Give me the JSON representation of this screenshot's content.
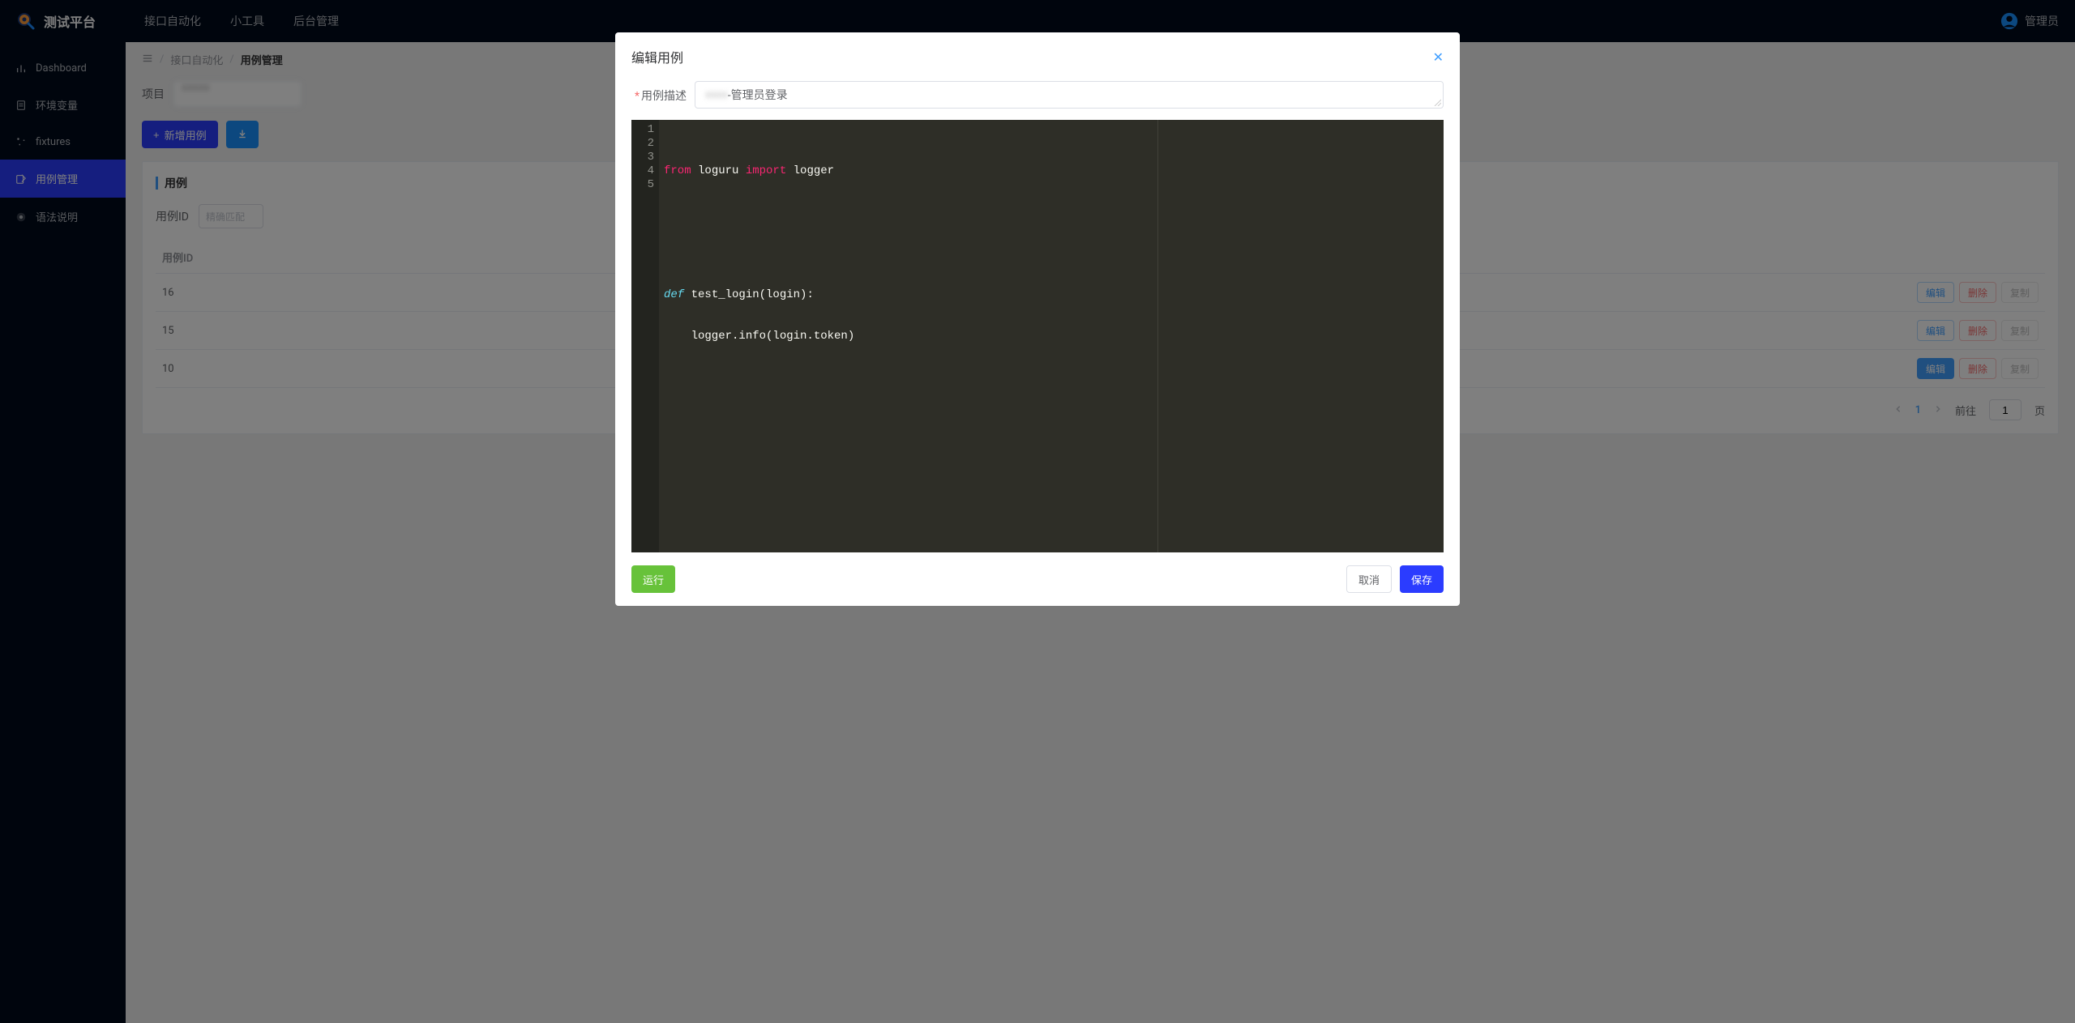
{
  "header": {
    "app_title": "测试平台",
    "nav": [
      "接口自动化",
      "小工具",
      "后台管理"
    ],
    "user_label": "管理员"
  },
  "sidebar": {
    "items": [
      {
        "label": "Dashboard",
        "active": false
      },
      {
        "label": "环境变量",
        "active": false
      },
      {
        "label": "fixtures",
        "active": false
      },
      {
        "label": "用例管理",
        "active": true
      },
      {
        "label": "语法说明",
        "active": false
      }
    ]
  },
  "breadcrumb": {
    "items": [
      "接口自动化",
      "用例管理"
    ]
  },
  "page": {
    "project_label": "项目",
    "add_button": "新增用例",
    "card_title": "用例",
    "filters": {
      "case_id_label": "用例ID",
      "matcher_placeholder": "精确匹配"
    },
    "table": {
      "header_id": "用例ID",
      "rows": [
        {
          "id": "16",
          "edit": "编辑",
          "delete": "删除",
          "copy": "复制",
          "edit_active": false
        },
        {
          "id": "15",
          "edit": "编辑",
          "delete": "删除",
          "copy": "复制",
          "edit_active": false
        },
        {
          "id": "10",
          "edit": "编辑",
          "delete": "删除",
          "copy": "复制",
          "edit_active": true
        }
      ]
    },
    "pagination": {
      "current": "1",
      "goto_label": "前往",
      "goto_value": "1",
      "page_suffix": "页"
    }
  },
  "dialog": {
    "title": "编辑用例",
    "desc_label": "用例描述",
    "desc_value_suffix": "-管理员登录",
    "code": {
      "lines": [
        "1",
        "2",
        "3",
        "4",
        "5"
      ],
      "line1_from": "from",
      "line1_loguru": " loguru ",
      "line1_import": "import",
      "line1_logger": " logger",
      "line4_def": "def",
      "line4_rest": " test_login(login):",
      "line5": "    logger.info(login.token)"
    },
    "footer": {
      "run": "运行",
      "cancel": "取消",
      "save": "保存"
    }
  }
}
